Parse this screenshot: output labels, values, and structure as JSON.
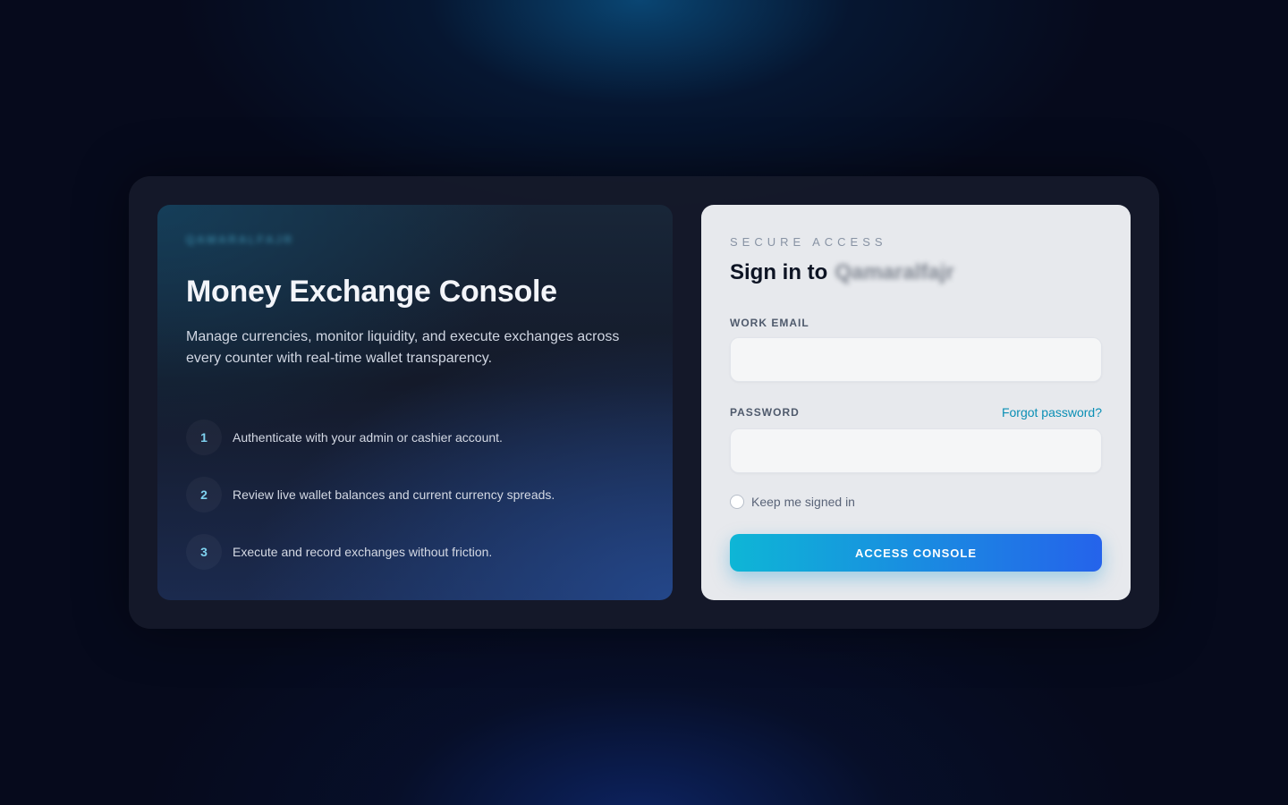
{
  "hero": {
    "brand": "QAMARALFAJR",
    "title": "Money Exchange Console",
    "description": "Manage currencies, monitor liquidity, and execute exchanges across every counter with real-time wallet transparency.",
    "steps": [
      {
        "number": "1",
        "text": "Authenticate with your admin or cashier account."
      },
      {
        "number": "2",
        "text": "Review live wallet balances and current currency spreads."
      },
      {
        "number": "3",
        "text": "Execute and record exchanges without friction."
      }
    ]
  },
  "login": {
    "eyebrow": "SECURE ACCESS",
    "title_prefix": "Sign in to",
    "org_name": "Qamaralfajr",
    "email_label": "WORK EMAIL",
    "email_value": "",
    "password_label": "PASSWORD",
    "password_value": "",
    "forgot_label": "Forgot password?",
    "remember_label": "Keep me signed in",
    "remember_checked": false,
    "submit_label": "ACCESS CONSOLE"
  },
  "colors": {
    "accent_start": "#0eb6d6",
    "accent_end": "#2563eb",
    "link": "#0a8fb5",
    "background": "#060a1c"
  }
}
